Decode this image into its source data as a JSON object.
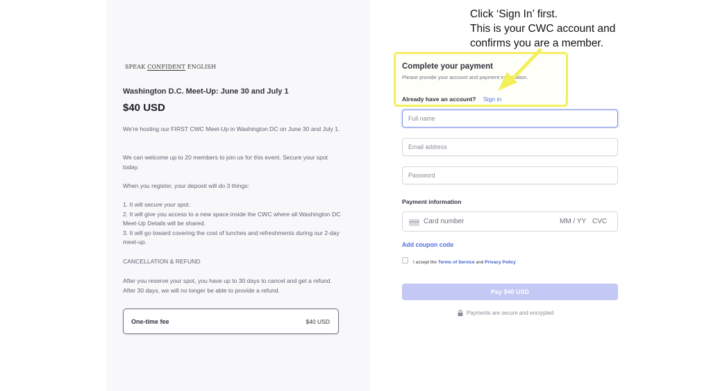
{
  "brand": {
    "name_parts": [
      "SPEAK ",
      "CONFIDENT",
      " ENGLISH"
    ]
  },
  "product": {
    "title": "Washington D.C. Meet-Up: June 30 and July 1",
    "price": "$40 USD",
    "paragraphs": [
      "We're hosting our FIRST CWC Meet-Up in Washington DC on June 30 and July 1.",
      "We can welcome up to 20 members to join us for this event. Secure your spot today.",
      "When you register, your deposit will do 3 things:",
      "1. It will secure your spot.\n2. It will give you access to a new space inside the CWC where all Washington DC Meet-Up Details will be shared.\n3. It will go toward covering the cost of lunches and refreshments during our 2-day meet-up.",
      "CANCELLATION & REFUND",
      "After you reserve your spot, you have up to 30 days to cancel and get a refund. After 30 days, we will no longer be able to provide a refund."
    ],
    "fee_label": "One-time fee",
    "fee_amount": "$40 USD"
  },
  "payment": {
    "heading": "Complete your payment",
    "subheading": "Please provide your account and payment information.",
    "account_prompt": "Already have an account?",
    "sign_in_link": "Sign in",
    "full_name_placeholder": "Full name",
    "email_placeholder": "Email address",
    "password_placeholder": "Password",
    "payment_info_label": "Payment information",
    "card_number_placeholder": "Card number",
    "card_expiry_placeholder": "MM / YY",
    "card_cvc_placeholder": "CVC",
    "coupon_link": "Add coupon code",
    "terms_prefix": "I accept the ",
    "terms_of_service": "Terms of Service",
    "terms_and": " and ",
    "privacy_policy": "Privacy Policy",
    "pay_button": "Pay $40 USD",
    "secure_note": "Payments are secure and encrypted",
    "terms_checked": false
  },
  "annotation": {
    "lines": [
      "Click ‘Sign In’ first.",
      "This is your CWC account and",
      "confirms you are a member."
    ],
    "highlight_color": "#f4ef5c"
  },
  "colors": {
    "link": "#4f6fe0",
    "pay_button_bg": "#c3c8f5",
    "left_panel_bg": "#f8f8fa"
  }
}
